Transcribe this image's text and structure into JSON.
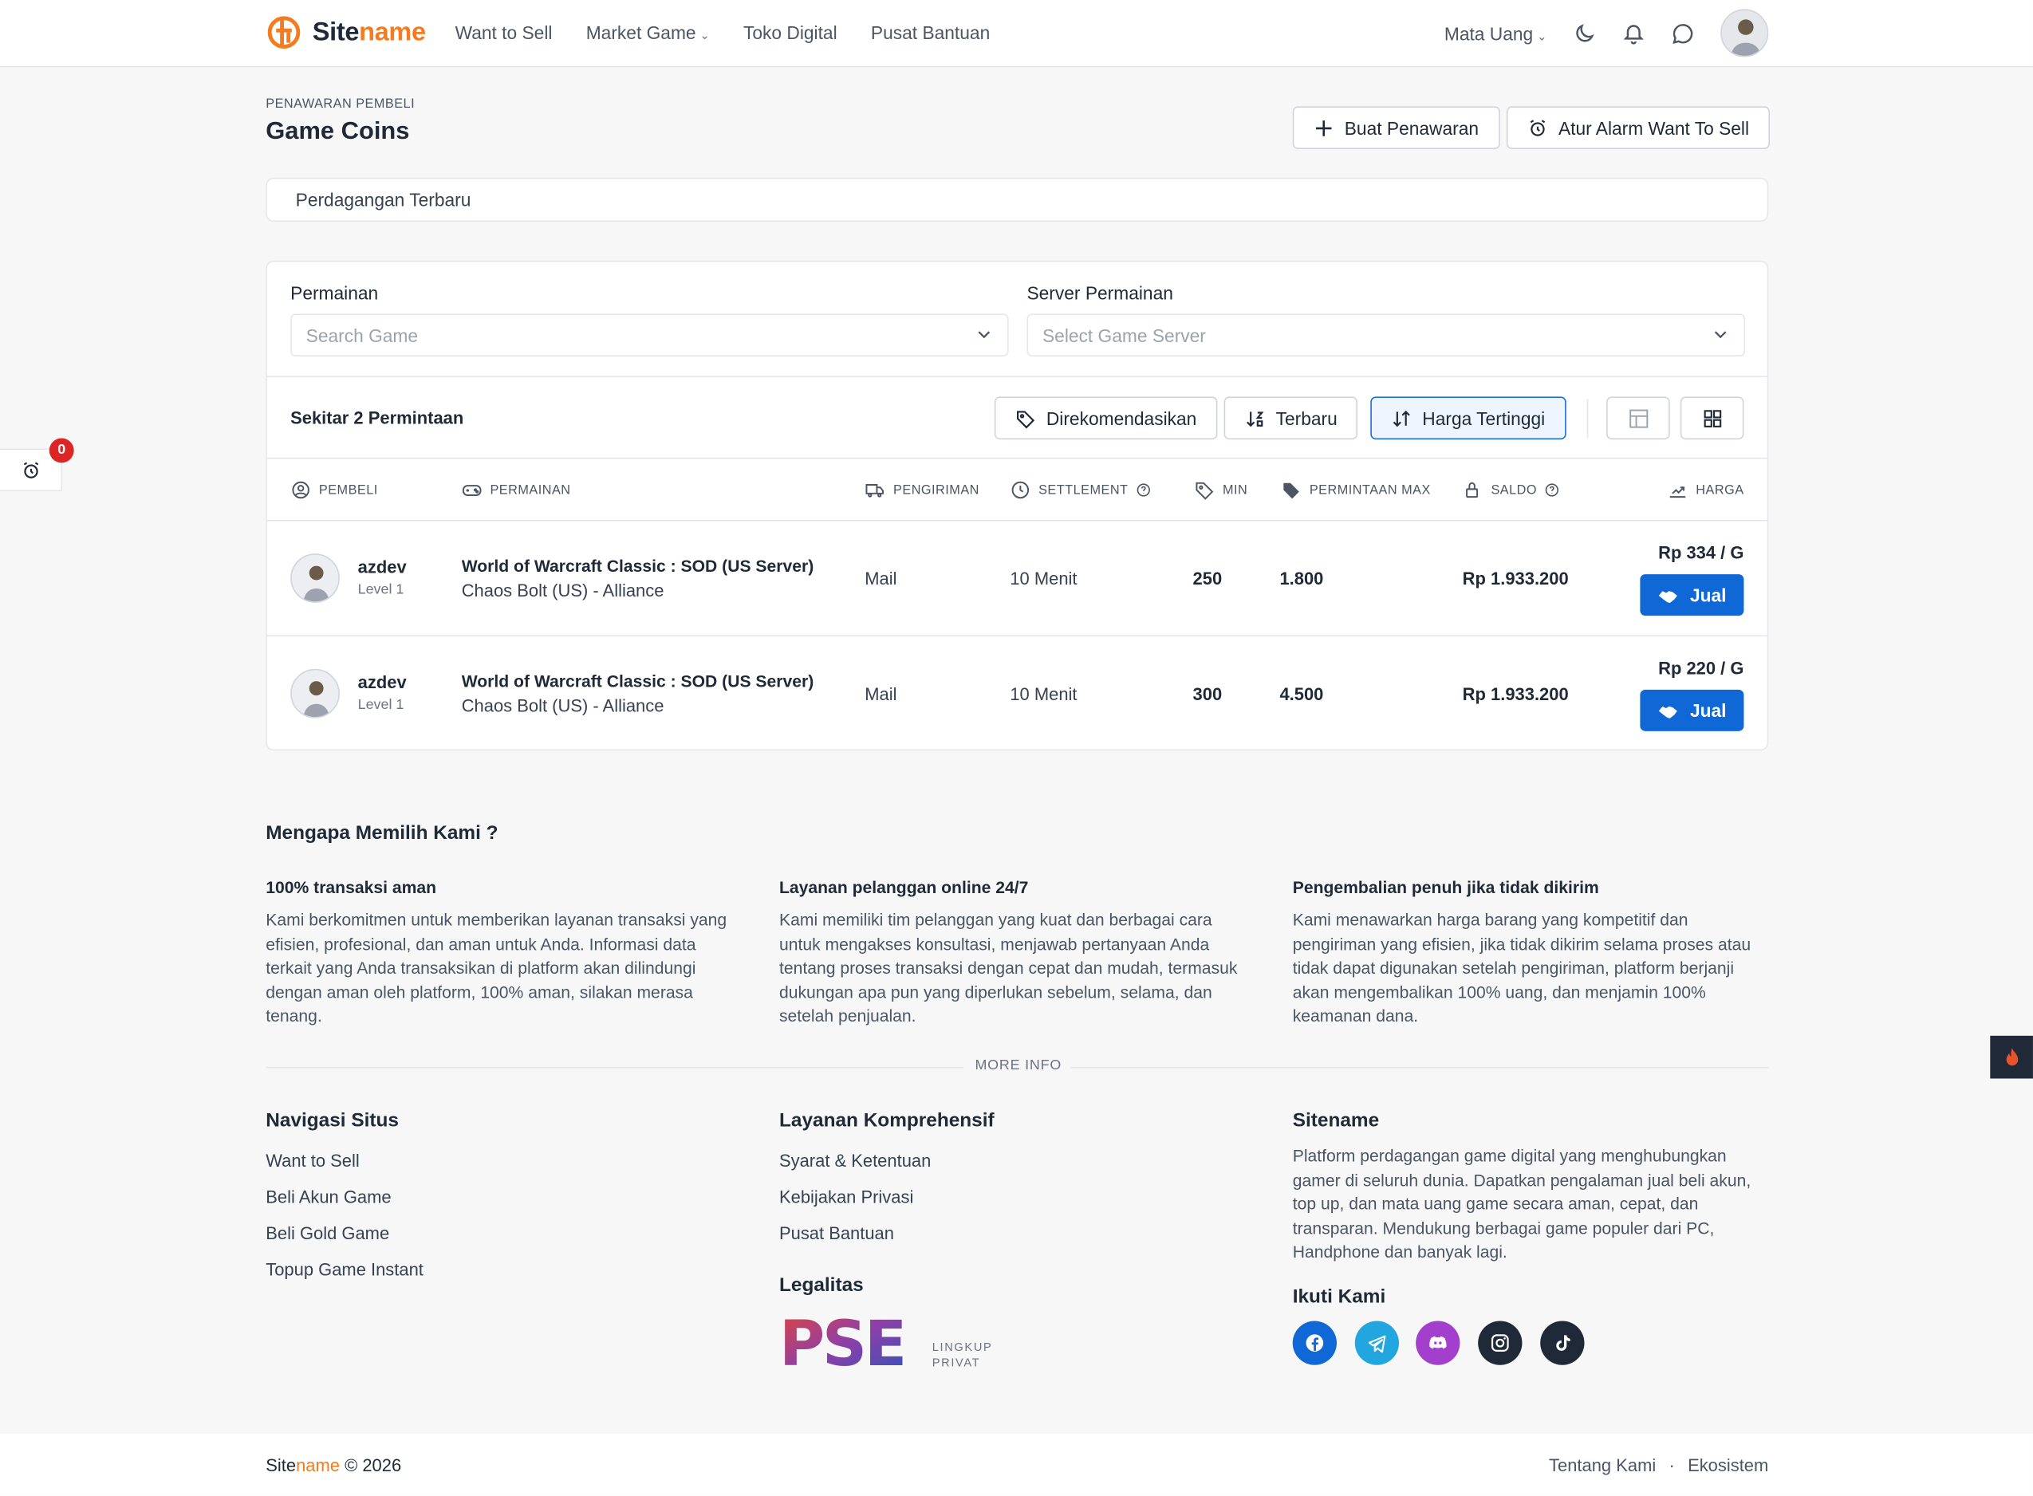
{
  "brand": {
    "name_main": "Site",
    "name_accent": "name",
    "accent_color": "#f47b20"
  },
  "nav": [
    {
      "label": "Want to Sell"
    },
    {
      "label": "Market Game",
      "has_dropdown": true
    },
    {
      "label": "Toko Digital"
    },
    {
      "label": "Pusat Bantuan"
    }
  ],
  "header": {
    "currency_label": "Mata Uang",
    "icons": [
      "moon-icon",
      "bell-icon",
      "chat-icon"
    ]
  },
  "page": {
    "breadcrumb": "PENAWARAN PEMBELI",
    "title": "Game Coins",
    "create_offer_label": "Buat Penawaran",
    "alarm_label": "Atur Alarm Want To Sell",
    "recent_label": "Perdagangan Terbaru"
  },
  "filters": {
    "game_label": "Permainan",
    "game_placeholder": "Search Game",
    "server_label": "Server Permainan",
    "server_placeholder": "Select Game Server"
  },
  "results": {
    "count_text": "Sekitar 2 Permintaan",
    "sort_options": [
      {
        "label": "Direkomendasikan",
        "active": false
      },
      {
        "label": "Terbaru",
        "active": false
      },
      {
        "label": "Harga Tertinggi",
        "active": true
      }
    ],
    "active_color": "#1d6fd8"
  },
  "table": {
    "headers": {
      "buyer": "PEMBELI",
      "game": "PERMAINAN",
      "delivery": "PENGIRIMAN",
      "settlement": "SETTLEMENT",
      "min": "MIN",
      "max": "PERMINTAAN MAX",
      "balance": "SALDO",
      "price": "HARGA"
    },
    "sell_label": "Jual",
    "sell_color": "#1068d6",
    "rows": [
      {
        "buyer": "azdev",
        "level": "Level 1",
        "game": "World of Warcraft Classic : SOD (US Server)",
        "server": "Chaos Bolt (US) - Alliance",
        "delivery": "Mail",
        "settlement": "10 Menit",
        "min": "250",
        "max": "1.800",
        "balance": "Rp 1.933.200",
        "price": "Rp 334 / G"
      },
      {
        "buyer": "azdev",
        "level": "Level 1",
        "game": "World of Warcraft Classic : SOD (US Server)",
        "server": "Chaos Bolt (US) - Alliance",
        "delivery": "Mail",
        "settlement": "10 Menit",
        "min": "300",
        "max": "4.500",
        "balance": "Rp 1.933.200",
        "price": "Rp 220 / G"
      }
    ]
  },
  "alarm_badge_count": "0",
  "why": {
    "title": "Mengapa Memilih Kami ?",
    "items": [
      {
        "title": "100% transaksi aman",
        "text": "Kami berkomitmen untuk memberikan layanan transaksi yang efisien, profesional, dan aman untuk Anda. Informasi data terkait yang Anda transaksikan di platform akan dilindungi dengan aman oleh platform, 100% aman, silakan merasa tenang."
      },
      {
        "title": "Layanan pelanggan online 24/7",
        "text": "Kami memiliki tim pelanggan yang kuat dan berbagai cara untuk mengakses konsultasi, menjawab pertanyaan Anda tentang proses transaksi dengan cepat dan mudah, termasuk dukungan apa pun yang diperlukan sebelum, selama, dan setelah penjualan."
      },
      {
        "title": "Pengembalian penuh jika tidak dikirim",
        "text": "Kami menawarkan harga barang yang kompetitif dan pengiriman yang efisien, jika tidak dikirim selama proses atau tidak dapat digunakan setelah pengiriman, platform berjanji akan mengembalikan 100% uang, dan menjamin 100% keamanan dana."
      }
    ],
    "more_info": "MORE INFO"
  },
  "footer_cols": {
    "nav_title": "Navigasi Situs",
    "nav_links": [
      "Want to Sell",
      "Beli Akun Game",
      "Beli Gold Game",
      "Topup Game Instant"
    ],
    "service_title": "Layanan Komprehensif",
    "service_links": [
      "Syarat & Ketentuan",
      "Kebijakan Privasi",
      "Pusat Bantuan"
    ],
    "legal_title": "Legalitas",
    "legal_logo_text": "PSE",
    "legal_logo_sub1": "LINGKUP",
    "legal_logo_sub2": "PRIVAT",
    "site_title": "Sitename",
    "site_desc": "Platform perdagangan game digital yang menghubungkan gamer di seluruh dunia. Dapatkan pengalaman jual beli akun, top up, dan mata uang game secara aman, cepat, dan transparan. Mendukung berbagai game populer dari PC, Handphone dan banyak lagi.",
    "follow_title": "Ikuti Kami",
    "socials": [
      {
        "icon": "facebook-icon",
        "color": "#1068d6"
      },
      {
        "icon": "telegram-icon",
        "color": "#22a6e0"
      },
      {
        "icon": "discord-icon",
        "color": "#a23fcc"
      },
      {
        "icon": "instagram-icon",
        "color": "#1f2937"
      },
      {
        "icon": "tiktok-icon",
        "color": "#1f2937"
      }
    ]
  },
  "footer": {
    "copyright_main": "Site",
    "copyright_accent": "name",
    "copyright_rest": " © 2026",
    "links": [
      "Tentang Kami",
      "Ekosistem"
    ],
    "separator": "·"
  }
}
